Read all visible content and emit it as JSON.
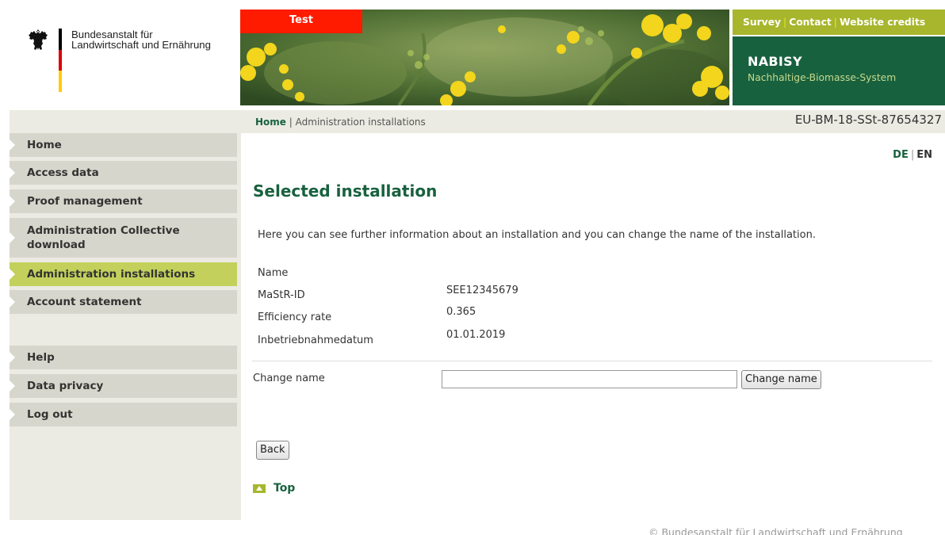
{
  "logo": {
    "line1": "Bundesanstalt für",
    "line2": "Landwirtschaft und Ernährung",
    "flag_colors": [
      "#000000",
      "#dd0000",
      "#ffcc00"
    ]
  },
  "banner": {
    "test_label": "Test"
  },
  "topnav": {
    "items": [
      "Survey",
      "Contact",
      "Website credits"
    ]
  },
  "brand": {
    "title": "NABISY",
    "subtitle": "Nachhaltige-Biomasse-System"
  },
  "breadcrumb": {
    "home": "Home",
    "separator": "|",
    "current": "Administration installations"
  },
  "doc_id": "EU-BM-18-SSt-87654327",
  "sidebar": {
    "items": [
      {
        "label": "Home"
      },
      {
        "label": "Access data"
      },
      {
        "label": "Proof management"
      },
      {
        "label": "Administration Collective download"
      },
      {
        "label": "Administration installations",
        "active": true
      },
      {
        "label": "Account statement"
      },
      {
        "label": "Help"
      },
      {
        "label": "Data privacy"
      },
      {
        "label": "Log out"
      }
    ]
  },
  "language": {
    "de": "DE",
    "separator": "|",
    "en": "EN",
    "selected": "EN"
  },
  "page": {
    "heading": "Selected installation",
    "intro": "Here you can see further information about an installation and you can change the name of the installation.",
    "fields": [
      {
        "label": "Name",
        "value": ""
      },
      {
        "label": "MaStR-ID",
        "value": "SEE12345679"
      },
      {
        "label": "Efficiency rate",
        "value": "0.365"
      },
      {
        "label": "Inbetriebnahmedatum",
        "value": "01.01.2019"
      }
    ],
    "change_name": {
      "label": "Change name",
      "value": "",
      "button": "Change name"
    },
    "back_button": "Back",
    "top_link": "Top"
  },
  "footer": {
    "copyright": "© Bundesanstalt für Landwirtschaft und Ernährung"
  },
  "colors": {
    "brand_green": "#18613e",
    "accent_lime": "#a7b62d",
    "active_nav": "#c3d15c",
    "test_red": "#fe1b00"
  },
  "icons": [
    "eagle-icon",
    "nav-triangle-icon",
    "arrow-up-icon"
  ]
}
